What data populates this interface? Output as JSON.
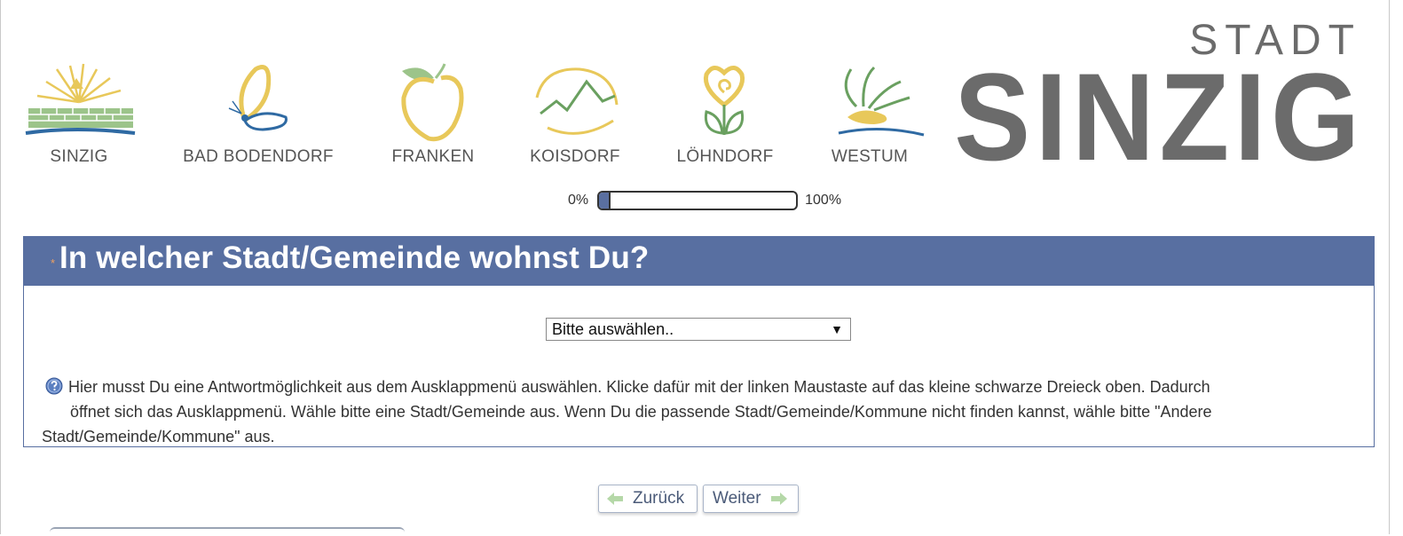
{
  "header": {
    "villages": [
      {
        "label": "SINZIG",
        "icon": "sinzig-wall-sun-icon"
      },
      {
        "label": "BAD BODENDORF",
        "icon": "butterfly-icon"
      },
      {
        "label": "FRANKEN",
        "icon": "apple-icon"
      },
      {
        "label": "KOISDORF",
        "icon": "mountain-icon"
      },
      {
        "label": "LÖHNDORF",
        "icon": "heart-flower-icon"
      },
      {
        "label": "WESTUM",
        "icon": "plant-icon"
      }
    ],
    "brand_top": "STADT",
    "brand_main": "SINZIG"
  },
  "progress": {
    "min_label": "0%",
    "max_label": "100%",
    "value": 0.05
  },
  "question": {
    "required_mark": "*",
    "text": "In welcher Stadt/Gemeinde wohnst Du?",
    "select_value": "Bitte auswählen..",
    "select_arrow": "▼",
    "help_line1": "Hier musst Du eine Antwortmöglichkeit aus dem Ausklappmenü auswählen. Klicke dafür mit der linken Maustaste auf das kleine schwarze Dreieck oben. Dadurch",
    "help_line2": "öffnet sich das Ausklappmenü. Wähle bitte eine Stadt/Gemeinde aus. Wenn Du die passende Stadt/Gemeinde/Kommune nicht finden kannst, wähle bitte \"Andere",
    "help_line3": "Stadt/Gemeinde/Kommune\" aus."
  },
  "nav": {
    "back_label": "Zurück",
    "next_label": "Weiter"
  },
  "colors": {
    "accent": "#586fa1",
    "logo_gray": "#6b6b6b",
    "arrow_green": "#b5d8a8",
    "required": "#f0a060"
  }
}
